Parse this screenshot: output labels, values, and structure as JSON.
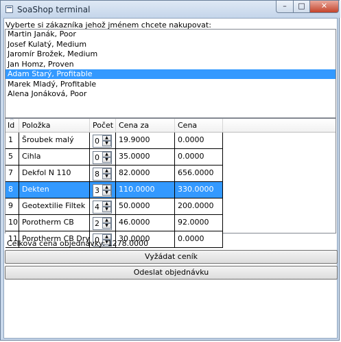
{
  "window": {
    "title": "SoaShop terminal",
    "minimize_glyph": "–",
    "maximize_glyph": "□",
    "close_glyph": "✕",
    "icon": "app-window-icon"
  },
  "customer_prompt": "Vyberte si zákazníka jehož jménem chcete nakupovat:",
  "customers": [
    "Martin Janák, Poor",
    "Josef Kulatý, Medium",
    "Jaromír Brožek, Medium",
    "Jan Homz, Proven",
    "Adam Starý, Profitable",
    "Marek Mladý, Profitable",
    "Alena Jonáková, Poor"
  ],
  "selected_customer_index": 4,
  "grid": {
    "sort_glyph": "^",
    "columns": [
      "Id",
      "Položka",
      "Počet",
      "Cena za položku",
      "Cena celkem"
    ],
    "rows": [
      {
        "id": "1",
        "item": "Šroubek malý",
        "qty": "0",
        "price": "19.9000",
        "total": "0.0000"
      },
      {
        "id": "5",
        "item": "Cihla",
        "qty": "0",
        "price": "35.0000",
        "total": "0.0000"
      },
      {
        "id": "7",
        "item": "Dekfol N 110",
        "qty": "8",
        "price": "82.0000",
        "total": "656.0000"
      },
      {
        "id": "8",
        "item": "Dekten",
        "qty": "3",
        "price": "110.0000",
        "total": "330.0000"
      },
      {
        "id": "9",
        "item": "Geotextilie Filtek",
        "qty": "4",
        "price": "50.0000",
        "total": "200.0000"
      },
      {
        "id": "10",
        "item": "Porotherm CB",
        "qty": "2",
        "price": "46.0000",
        "total": "92.0000"
      },
      {
        "id": "11",
        "item": "Porotherm CB Dryfix",
        "qty": "0",
        "price": "30.0000",
        "total": "0.0000"
      }
    ],
    "selected_row_index": 3
  },
  "order_total_label": "Celková cena objednávky:",
  "order_total_value": "1278.0000",
  "buttons": {
    "request_price_list": "Vyžádat ceník",
    "send_order": "Odeslat objednávku"
  },
  "colors": {
    "selection": "#3399ff",
    "titlebar": "#c9d9ec",
    "close_button": "#c4432b"
  }
}
